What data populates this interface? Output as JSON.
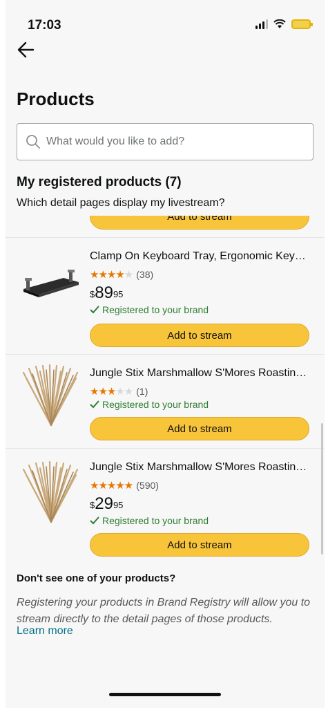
{
  "status_bar": {
    "time": "17:03"
  },
  "header": {
    "title": "Products"
  },
  "search": {
    "placeholder": "What would you like to add?"
  },
  "section": {
    "title": "My registered products (7)",
    "subtitle": "Which detail pages display my livestream?"
  },
  "partial_button_label": "Add to stream",
  "products": [
    {
      "title": "Clamp On Keyboard Tray, Ergonomic Keyb…",
      "rating_stars": 4,
      "rating_count": "(38)",
      "price_currency": "$",
      "price_whole": "89",
      "price_fraction": "95",
      "registered": "Registered to your brand",
      "button": "Add to stream",
      "image": "keyboard-tray"
    },
    {
      "title": "Jungle Stix Marshmallow S'Mores Roasting…",
      "rating_stars": 3,
      "rating_count": "(1)",
      "registered": "Registered to your brand",
      "button": "Add to stream",
      "image": "roasting-sticks"
    },
    {
      "title": "Jungle Stix Marshmallow S'Mores Roasting…",
      "rating_stars": 5,
      "rating_count": "(590)",
      "price_currency": "$",
      "price_whole": "29",
      "price_fraction": "95",
      "registered": "Registered to your brand",
      "button": "Add to stream",
      "image": "roasting-sticks"
    }
  ],
  "help": {
    "title": "Don't see one of your products?",
    "text": "Registering your products in Brand Registry will allow you to stream directly to the detail pages of those products.",
    "link": "Learn more"
  },
  "colors": {
    "button_yellow": "#f8c43a",
    "registered_green": "#2e7d32",
    "star_orange": "#e77600",
    "link_teal": "#007185"
  },
  "icons": [
    "back-arrow-icon",
    "search-icon",
    "checkmark-icon",
    "star-icon",
    "signal-icon",
    "wifi-icon",
    "battery-icon"
  ]
}
